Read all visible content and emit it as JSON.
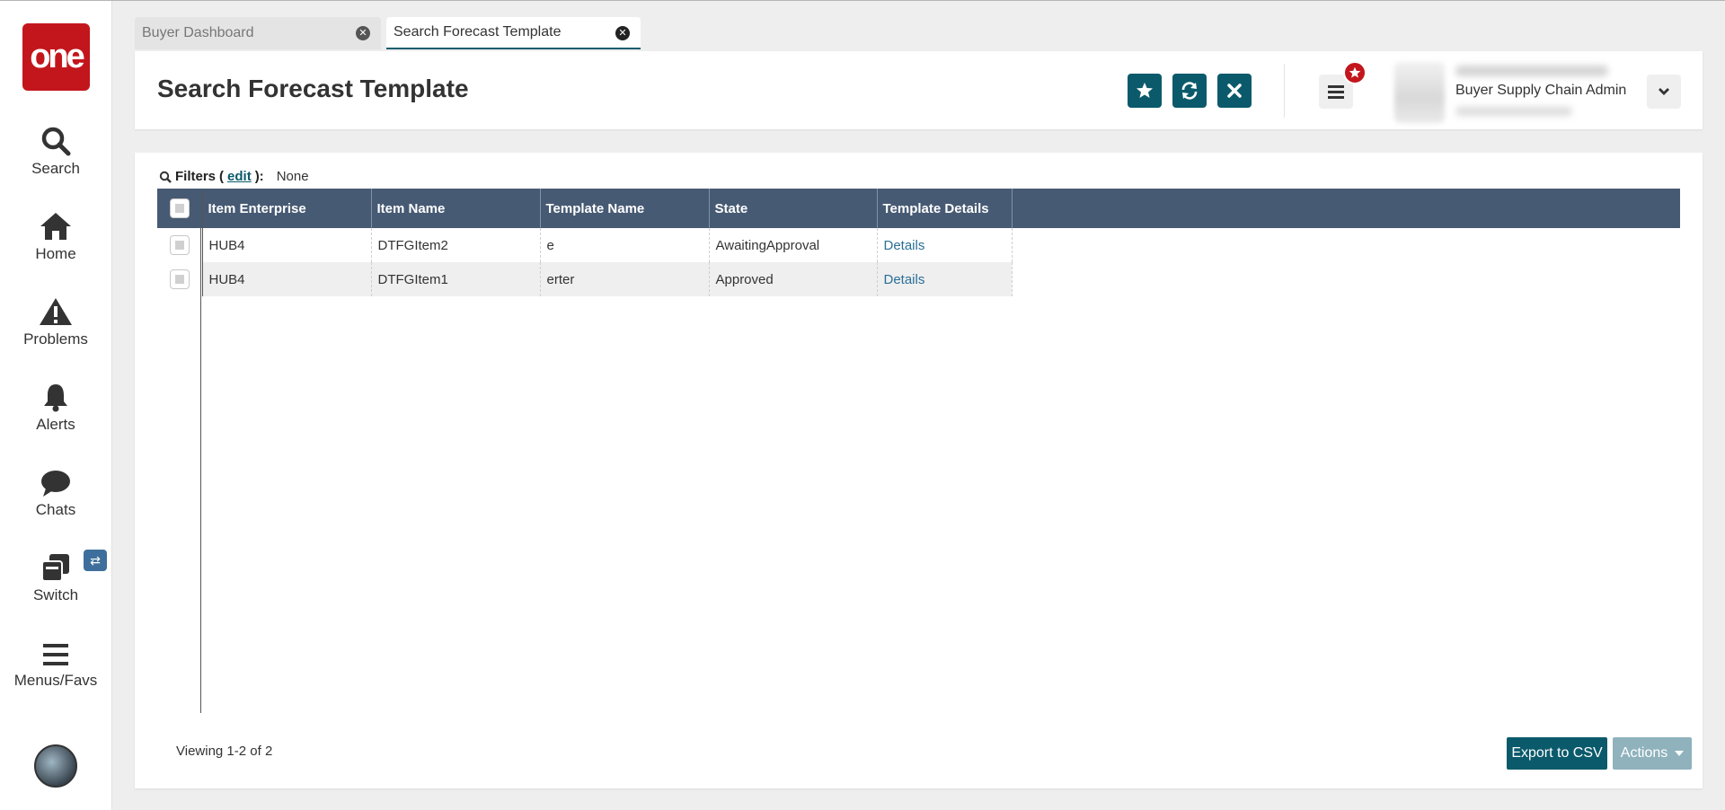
{
  "app": {
    "logo_text": "one",
    "brand_color": "#c3161c",
    "accent_color": "#0b5a6b",
    "grid_header_color": "#475a74"
  },
  "sidebar": {
    "items": [
      {
        "label": "Search",
        "icon": "search-icon"
      },
      {
        "label": "Home",
        "icon": "home-icon"
      },
      {
        "label": "Problems",
        "icon": "warning-icon"
      },
      {
        "label": "Alerts",
        "icon": "bell-icon"
      },
      {
        "label": "Chats",
        "icon": "chat-bubble-icon"
      },
      {
        "label": "Switch",
        "icon": "switch-icon"
      },
      {
        "label": "Menus/Favs",
        "icon": "hamburger-icon"
      }
    ],
    "switch_badge_icon": "swap-arrows-icon"
  },
  "tabs": [
    {
      "label": "Buyer Dashboard",
      "active": false
    },
    {
      "label": "Search Forecast Template",
      "active": true
    }
  ],
  "header": {
    "title": "Search Forecast Template",
    "buttons": [
      "star-icon",
      "refresh-icon",
      "close-icon"
    ],
    "user_name": "Buyer Supply Chain Admin"
  },
  "filters": {
    "label": "Filters",
    "edit_label": "edit",
    "value": "None"
  },
  "grid": {
    "columns": [
      "Item Enterprise",
      "Item Name",
      "Template Name",
      "State",
      "Template Details"
    ],
    "rows": [
      [
        "HUB4",
        "DTFGItem2",
        "e",
        "AwaitingApproval",
        "Details"
      ],
      [
        "HUB4",
        "DTFGItem1",
        "erter",
        "Approved",
        "Details"
      ]
    ]
  },
  "footer": {
    "viewing": "Viewing 1-2 of 2",
    "export_label": "Export to CSV",
    "actions_label": "Actions"
  }
}
